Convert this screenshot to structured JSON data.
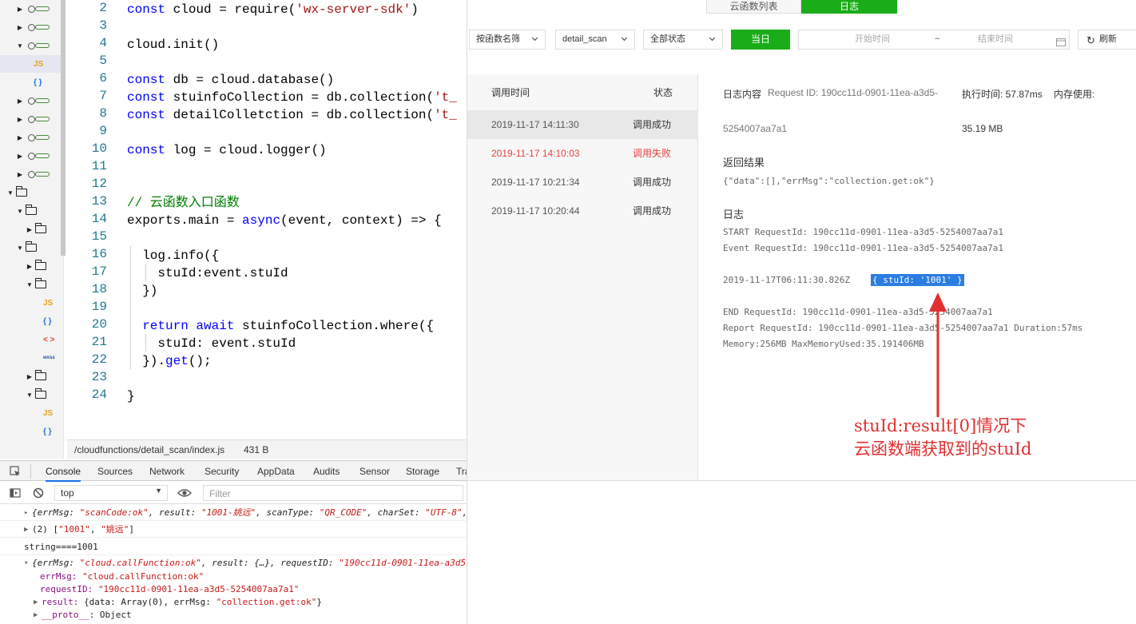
{
  "file_tree": {
    "items": [
      {
        "type": "cloud",
        "arrow": "▶"
      },
      {
        "type": "cloud",
        "arrow": "▶"
      },
      {
        "type": "cloud",
        "arrow": "▼"
      },
      {
        "type": "js",
        "label": "JS"
      },
      {
        "type": "json",
        "label": "{ }"
      },
      {
        "type": "cloud",
        "arrow": "▶"
      },
      {
        "type": "cloud",
        "arrow": "▶"
      },
      {
        "type": "cloud",
        "arrow": "▶"
      },
      {
        "type": "cloud",
        "arrow": "▶"
      },
      {
        "type": "cloud",
        "arrow": "▶"
      },
      {
        "type": "folder",
        "arrow": "▼"
      },
      {
        "type": "folder",
        "arrow": "▼"
      },
      {
        "type": "folder",
        "arrow": "▶"
      },
      {
        "type": "folder",
        "arrow": "▼"
      },
      {
        "type": "folder",
        "arrow": "▶"
      },
      {
        "type": "folder",
        "arrow": "▼"
      },
      {
        "type": "js",
        "label": "JS"
      },
      {
        "type": "json",
        "label": "{ }"
      },
      {
        "type": "html",
        "label": "< >"
      },
      {
        "type": "wx",
        "label": "wxss"
      },
      {
        "type": "folder",
        "arrow": "▶"
      },
      {
        "type": "folder",
        "arrow": "▼"
      },
      {
        "type": "js",
        "label": "JS"
      },
      {
        "type": "json",
        "label": "{ }"
      }
    ]
  },
  "editor": {
    "line_numbers": [
      "2",
      "3",
      "4",
      "5",
      "6",
      "7",
      "8",
      "9",
      "10",
      "11",
      "12",
      "13",
      "14",
      "15",
      "16",
      "17",
      "18",
      "19",
      "20",
      "21",
      "22",
      "23",
      "24"
    ],
    "lines": [
      [
        {
          "t": "const",
          "c": "kw"
        },
        {
          "t": " cloud = require("
        },
        {
          "t": "'wx-server-sdk'",
          "c": "str"
        },
        {
          "t": ")"
        }
      ],
      [],
      [
        {
          "t": "cloud.init()"
        }
      ],
      [],
      [
        {
          "t": "const",
          "c": "kw"
        },
        {
          "t": " db = cloud.database()"
        }
      ],
      [
        {
          "t": "const",
          "c": "kw"
        },
        {
          "t": " stuinfoCollection = db.collection("
        },
        {
          "t": "'t_",
          "c": "str"
        }
      ],
      [
        {
          "t": "const",
          "c": "kw"
        },
        {
          "t": " detailColletction = db.collection("
        },
        {
          "t": "'t_",
          "c": "str"
        }
      ],
      [],
      [
        {
          "t": "const",
          "c": "kw"
        },
        {
          "t": " log = cloud.logger()"
        }
      ],
      [],
      [],
      [
        {
          "t": "// 云函数入口函数",
          "c": "cm"
        }
      ],
      [
        {
          "t": "exports.main = "
        },
        {
          "t": "async",
          "c": "kw"
        },
        {
          "t": "(event, context) => {"
        }
      ],
      [],
      [
        {
          "t": "  log.info({"
        }
      ],
      [
        {
          "t": "    stuId:event.stuId"
        }
      ],
      [
        {
          "t": "  })"
        }
      ],
      [],
      [
        {
          "t": "  "
        },
        {
          "t": "return await",
          "c": "kw"
        },
        {
          "t": " stuinfoCollection.where({"
        }
      ],
      [
        {
          "t": "    stuId: event.stuId"
        }
      ],
      [
        {
          "t": "  })."
        },
        {
          "t": "get",
          "c": "kw"
        },
        {
          "t": "();"
        }
      ],
      [],
      [
        {
          "t": "}"
        }
      ]
    ],
    "status_path": "/cloudfunctions/detail_scan/index.js",
    "status_size": "431 B"
  },
  "devtools": {
    "tabs": [
      "Console",
      "Sources",
      "Network",
      "Security",
      "AppData",
      "Audits",
      "Sensor",
      "Storage",
      "Tra"
    ],
    "active_tab": "Console",
    "context": "top",
    "filter_placeholder": "Filter",
    "console_lines": [
      {
        "parts": [
          {
            "t": "{errMsg: ",
            "c": "cp"
          },
          {
            "t": "\"scanCode:ok\"",
            "c": "cs"
          },
          {
            "t": ", result: ",
            "c": "cp"
          },
          {
            "t": "\"1001-姚远\"",
            "c": "cs"
          },
          {
            "t": ", scanType: ",
            "c": "cp"
          },
          {
            "t": "\"QR_CODE\"",
            "c": "cs"
          },
          {
            "t": ", charSet: ",
            "c": "cp"
          },
          {
            "t": "\"UTF-8\"",
            "c": "cs"
          },
          {
            "t": ",",
            "c": "cp"
          }
        ],
        "arrow": "▸",
        "italic": true
      },
      {
        "parts": [
          {
            "t": "(2) [",
            "c": "cp"
          },
          {
            "t": "\"1001\"",
            "c": "cs"
          },
          {
            "t": ", ",
            "c": "cp"
          },
          {
            "t": "\"姚远\"",
            "c": "cs"
          },
          {
            "t": "]",
            "c": "cp"
          }
        ],
        "arrow": "▶",
        "italic": false
      },
      {
        "parts": [
          {
            "t": "string====1001",
            "c": "cp"
          }
        ],
        "arrow": "",
        "italic": false
      },
      {
        "parts": [
          {
            "t": "{errMsg: ",
            "c": "cp"
          },
          {
            "t": "\"cloud.callFunction:ok\"",
            "c": "cs"
          },
          {
            "t": ", result: {…}, requestID: ",
            "c": "cp"
          },
          {
            "t": "\"190cc11d-0901-11ea-a3d5-",
            "c": "cs"
          }
        ],
        "arrow": "▾",
        "italic": true
      },
      {
        "parts": [
          {
            "t": "errMsg: ",
            "c": "ck"
          },
          {
            "t": "\"cloud.callFunction:ok\"",
            "c": "cs"
          }
        ],
        "arrow": "",
        "italic": false,
        "indent": true
      },
      {
        "parts": [
          {
            "t": "requestID: ",
            "c": "ck"
          },
          {
            "t": "\"190cc11d-0901-11ea-a3d5-5254007aa7a1\"",
            "c": "cs"
          }
        ],
        "arrow": "",
        "italic": false,
        "indent": true
      },
      {
        "parts": [
          {
            "t": "result: ",
            "c": "ck"
          },
          {
            "t": "{data: Array(0), errMsg: ",
            "c": "cp"
          },
          {
            "t": "\"collection.get:ok\"",
            "c": "cs"
          },
          {
            "t": "}",
            "c": "cp"
          }
        ],
        "arrow": "▶",
        "italic": false,
        "indent": true
      },
      {
        "parts": [
          {
            "t": "__proto__",
            "c": "ck"
          },
          {
            "t": ": Object",
            "c": "cp"
          }
        ],
        "arrow": "▶",
        "italic": false,
        "indent": true
      }
    ]
  },
  "log_panel": {
    "top_tabs": [
      "云函数列表",
      "日志"
    ],
    "active_top_tab": "日志",
    "filter_function": "按函数名筛",
    "function_selected": "detail_scan",
    "status_filter": "全部状态",
    "today_button": "当日",
    "start_time_placeholder": "开始时间",
    "range_separator": "~",
    "end_time_placeholder": "结束时间",
    "refresh_button": "刷新",
    "list_headers": {
      "time": "调用时间",
      "status": "状态"
    },
    "list_rows": [
      {
        "time": "2019-11-17 14:11:30",
        "status": "调用成功",
        "failed": false,
        "selected": true
      },
      {
        "time": "2019-11-17 14:10:03",
        "status": "调用失败",
        "failed": true,
        "selected": false
      },
      {
        "time": "2019-11-17 10:21:34",
        "status": "调用成功",
        "failed": false,
        "selected": false
      },
      {
        "time": "2019-11-17 10:20:44",
        "status": "调用成功",
        "failed": false,
        "selected": false
      }
    ],
    "detail": {
      "content_label": "日志内容",
      "request_id_line1": "Request ID: 190cc11d-0901-11ea-a3d5-",
      "request_id_line2": "5254007aa7a1",
      "exec_time": "执行时间: 57.87ms",
      "mem_label": "内存使用:",
      "mem_value": "35.19 MB",
      "result_label": "返回结果",
      "result_value": "{\"data\":[],\"errMsg\":\"collection.get:ok\"}",
      "log_label": "日志",
      "log_lines": [
        "START RequestId: 190cc11d-0901-11ea-a3d5-5254007aa7a1",
        "Event RequestId: 190cc11d-0901-11ea-a3d5-5254007aa7a1"
      ],
      "log_timestamp": "2019-11-17T06:11:30.826Z",
      "log_highlight": "{ stuId: '1001' }",
      "end_lines": [
        "END RequestId: 190cc11d-0901-11ea-a3d5-5254007aa7a1",
        "Report RequestId: 190cc11d-0901-11ea-a3d5-5254007aa7a1 Duration:57ms",
        "Memory:256MB MaxMemoryUsed:35.191406MB"
      ]
    },
    "annotation_line1": "stuId:result[0]情况下",
    "annotation_line2": "云函数端获取到的stuId"
  },
  "colors": {
    "accent_green": "#1aad19",
    "fail_red": "#e64340",
    "annotation_red": "#e03030",
    "highlight_blue": "#2a7de1"
  }
}
